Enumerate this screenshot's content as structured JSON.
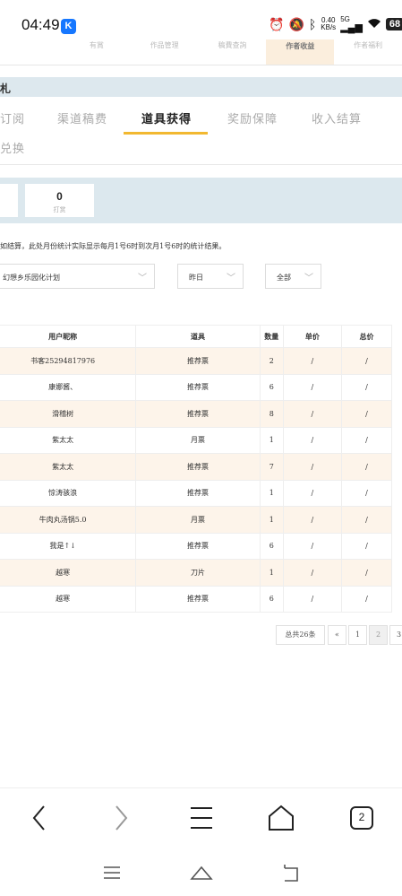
{
  "status_bar": {
    "time": "04:49",
    "app_badge": "K",
    "net_speed_value": "0.40",
    "net_speed_unit": "KB/s",
    "network": "5G",
    "battery": "68"
  },
  "top_tabs": [
    "有賞",
    "作品管理",
    "稿費查詢",
    "作者收益",
    "作者福利"
  ],
  "section_header": "札",
  "tabs": [
    {
      "label": "订阅"
    },
    {
      "label": "渠道稿费"
    },
    {
      "label": "道具获得"
    },
    {
      "label": "奖励保障"
    },
    {
      "label": "收入结算"
    },
    {
      "label": "兑换"
    }
  ],
  "stats": {
    "value": "0",
    "label": "打赏"
  },
  "notice": "如结算，此处月份统计实际显示每月1号6时到次月1号6时的统计结果。",
  "filters": {
    "book": "幻想乡乐园化计划",
    "date": "昨日",
    "type": "全部"
  },
  "table": {
    "headers": [
      "用户昵称",
      "道具",
      "数量",
      "单价",
      "总价"
    ],
    "rows": [
      [
        "书客25294817976",
        "推荐票",
        "2",
        "/",
        "/"
      ],
      [
        "康娜酱、",
        "推荐票",
        "6",
        "/",
        "/"
      ],
      [
        "滑稽树",
        "推荐票",
        "8",
        "/",
        "/"
      ],
      [
        "紫太太",
        "月票",
        "1",
        "/",
        "/"
      ],
      [
        "紫太太",
        "推荐票",
        "7",
        "/",
        "/"
      ],
      [
        "惊涛骇浪",
        "推荐票",
        "1",
        "/",
        "/"
      ],
      [
        "牛肉丸汤锅5.0",
        "月票",
        "1",
        "/",
        "/"
      ],
      [
        "我是↑↓",
        "推荐票",
        "6",
        "/",
        "/"
      ],
      [
        "越寒",
        "刀片",
        "1",
        "/",
        "/"
      ],
      [
        "越寒",
        "推荐票",
        "6",
        "/",
        "/"
      ]
    ]
  },
  "pagination": {
    "total": "总共26条",
    "prev": "«",
    "pages": [
      "1",
      "2",
      "3"
    ]
  },
  "browser_bar": {
    "tab_count": "2"
  }
}
